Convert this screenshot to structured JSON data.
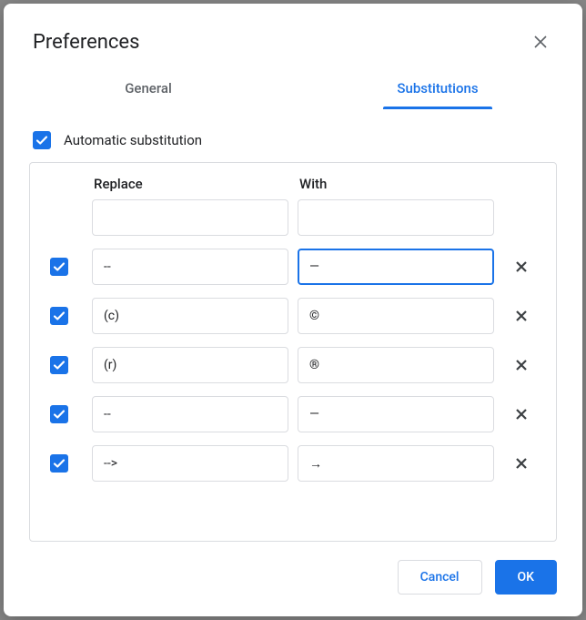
{
  "dialog": {
    "title": "Preferences",
    "close_icon": "close"
  },
  "tabs": {
    "general": "General",
    "substitutions": "Substitutions"
  },
  "auto_sub": {
    "checked": true,
    "label": "Automatic substitution"
  },
  "columns": {
    "replace": "Replace",
    "with": "With"
  },
  "rows": [
    {
      "enabled": null,
      "replace": "",
      "with": "",
      "removable": false,
      "with_focused": false
    },
    {
      "enabled": true,
      "replace": "--",
      "with": "—",
      "removable": true,
      "with_focused": true
    },
    {
      "enabled": true,
      "replace": "(c)",
      "with": "©",
      "removable": true,
      "with_focused": false
    },
    {
      "enabled": true,
      "replace": "(r)",
      "with": "®",
      "removable": true,
      "with_focused": false
    },
    {
      "enabled": true,
      "replace": "--",
      "with": "—",
      "removable": true,
      "with_focused": false
    },
    {
      "enabled": true,
      "replace": "-->",
      "with": "→",
      "removable": true,
      "with_focused": false
    }
  ],
  "footer": {
    "cancel": "Cancel",
    "ok": "OK"
  }
}
